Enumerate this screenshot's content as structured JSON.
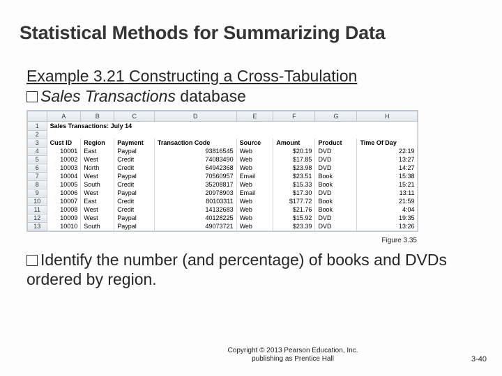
{
  "title": "Statistical Methods for Summarizing Data",
  "example_label": "Example 3.21",
  "example_rest": "  Constructing a Cross-Tabulation",
  "bullet1_italic": "Sales Transactions",
  "bullet1_rest": " database",
  "figure_caption": "Figure 3.35",
  "bullet2_start": "Identify",
  "bullet2_rest": " the number (and percentage) of books and DVDs ordered by region.",
  "copyright_line1": "Copyright © 2013 Pearson Education, Inc.",
  "copyright_line2": "publishing as Prentice Hall",
  "slide_number": "3-40",
  "sheet": {
    "col_letters": [
      "A",
      "B",
      "C",
      "D",
      "E",
      "F",
      "G",
      "H"
    ],
    "title_cell": "Sales Transactions: July 14",
    "headers": [
      "Cust ID",
      "Region",
      "Payment",
      "Transaction Code",
      "Source",
      "Amount",
      "Product",
      "Time Of Day"
    ],
    "rows": [
      {
        "n": "4",
        "cust": "10001",
        "region": "East",
        "payment": "Paypal",
        "code": "93816545",
        "source": "Web",
        "amount": "$20.19",
        "product": "DVD",
        "time": "22:19"
      },
      {
        "n": "5",
        "cust": "10002",
        "region": "West",
        "payment": "Credit",
        "code": "74083490",
        "source": "Web",
        "amount": "$17.85",
        "product": "DVD",
        "time": "13:27"
      },
      {
        "n": "6",
        "cust": "10003",
        "region": "North",
        "payment": "Credit",
        "code": "64942368",
        "source": "Web",
        "amount": "$23.98",
        "product": "DVD",
        "time": "14:27"
      },
      {
        "n": "7",
        "cust": "10004",
        "region": "West",
        "payment": "Paypal",
        "code": "70560957",
        "source": "Email",
        "amount": "$23.51",
        "product": "Book",
        "time": "15:38"
      },
      {
        "n": "8",
        "cust": "10005",
        "region": "South",
        "payment": "Credit",
        "code": "35208817",
        "source": "Web",
        "amount": "$15.33",
        "product": "Book",
        "time": "15:21"
      },
      {
        "n": "9",
        "cust": "10006",
        "region": "West",
        "payment": "Paypal",
        "code": "20978903",
        "source": "Email",
        "amount": "$17.30",
        "product": "DVD",
        "time": "13:11"
      },
      {
        "n": "10",
        "cust": "10007",
        "region": "East",
        "payment": "Credit",
        "code": "80103311",
        "source": "Web",
        "amount": "$177.72",
        "product": "Book",
        "time": "21:59"
      },
      {
        "n": "11",
        "cust": "10008",
        "region": "West",
        "payment": "Credit",
        "code": "14132683",
        "source": "Web",
        "amount": "$21.76",
        "product": "Book",
        "time": "4:04"
      },
      {
        "n": "12",
        "cust": "10009",
        "region": "West",
        "payment": "Paypal",
        "code": "40128225",
        "source": "Web",
        "amount": "$15.92",
        "product": "DVD",
        "time": "19:35"
      },
      {
        "n": "13",
        "cust": "10010",
        "region": "South",
        "payment": "Paypal",
        "code": "49073721",
        "source": "Web",
        "amount": "$23.39",
        "product": "DVD",
        "time": "13:26"
      }
    ]
  }
}
